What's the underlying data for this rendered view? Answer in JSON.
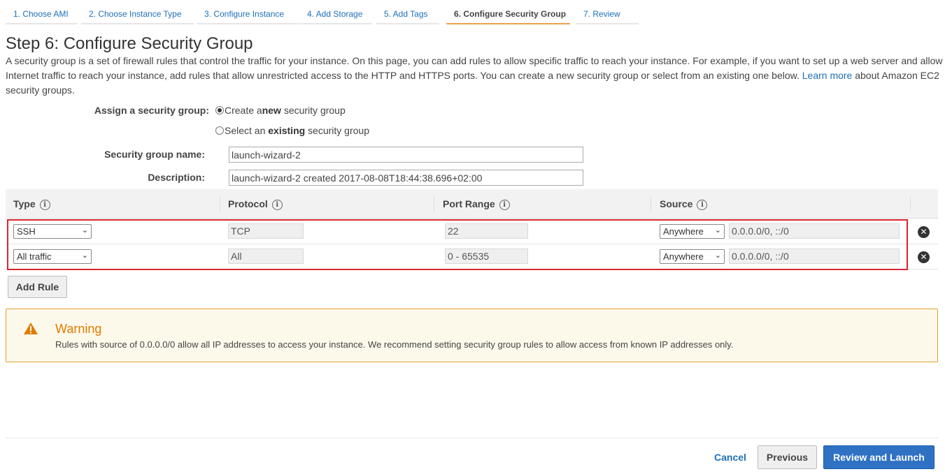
{
  "tabs": [
    {
      "label": "1. Choose AMI"
    },
    {
      "label": "2. Choose Instance Type"
    },
    {
      "label": "3. Configure Instance"
    },
    {
      "label": "4. Add Storage"
    },
    {
      "label": "5. Add Tags"
    },
    {
      "label": "6. Configure Security Group",
      "active": true
    },
    {
      "label": "7. Review"
    }
  ],
  "page": {
    "title": "Step 6: Configure Security Group",
    "intro": "A security group is a set of firewall rules that control the traffic for your instance. On this page, you can add rules to allow specific traffic to reach your instance. For example, if you want to set up a web server and allow Internet traffic to reach your instance, add rules that allow unrestricted access to the HTTP and HTTPS ports. You can create a new security group or select from an existing one below.",
    "learn_more": "Learn more",
    "intro_tail": "about Amazon EC2 security groups."
  },
  "assign": {
    "label": "Assign a security group:",
    "option_new_pre": "Create a ",
    "option_new_bold": "new",
    "option_new_post": " security group",
    "option_existing_pre": "Select an ",
    "option_existing_bold": "existing",
    "option_existing_post": " security group",
    "selected": "new"
  },
  "group_name": {
    "label": "Security group name:",
    "value": "launch-wizard-2"
  },
  "description": {
    "label": "Description:",
    "value": "launch-wizard-2 created 2017-08-08T18:44:38.696+02:00"
  },
  "table": {
    "headers": [
      "Type",
      "Protocol",
      "Port Range",
      "Source"
    ],
    "info_icon": "i",
    "rows": [
      {
        "type": "SSH",
        "protocol": "TCP",
        "port": "22",
        "source": "Anywhere",
        "cidr": "0.0.0.0/0, ::/0"
      },
      {
        "type": "All traffic",
        "protocol": "All",
        "port": "0 - 65535",
        "source": "Anywhere",
        "cidr": "0.0.0.0/0, ::/0"
      }
    ],
    "remove_glyph": "✕",
    "add_rule": "Add Rule"
  },
  "warning": {
    "title": "Warning",
    "text": "Rules with source of 0.0.0.0/0 allow all IP addresses to access your instance. We recommend setting security group rules to allow access from known IP addresses only."
  },
  "footer": {
    "cancel": "Cancel",
    "previous": "Previous",
    "launch": "Review and Launch"
  },
  "colors": {
    "accent": "#1e6fb8",
    "tab_active": "#f0a04b",
    "highlight": "#d9262e",
    "warning": "#e07b00",
    "primary_button": "#2f72c4"
  }
}
